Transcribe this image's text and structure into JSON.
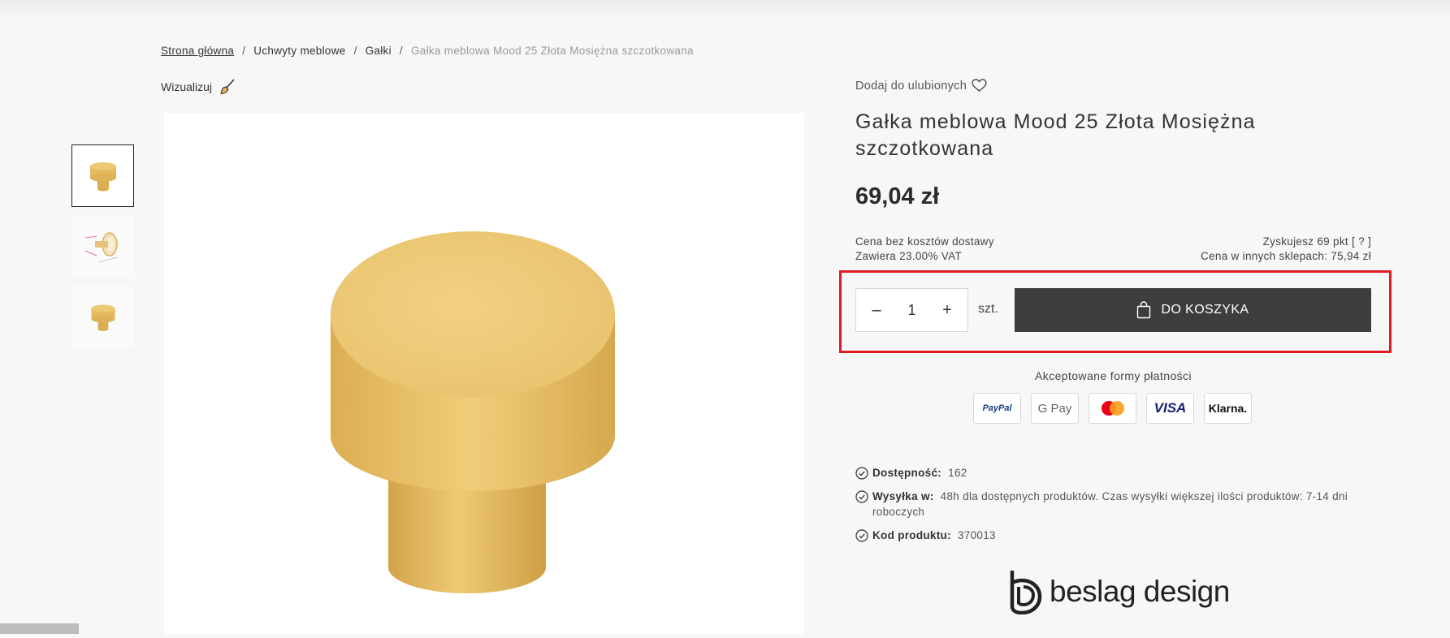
{
  "breadcrumb": {
    "home": "Strona główna",
    "level1": "Uchwyty meblowe",
    "level2": "Gałki",
    "current": "Gałka meblowa Mood 25 Złota Mosiężna szczotkowana",
    "sep": "/"
  },
  "visualize_label": "Wizualizuj",
  "favorites_label": "Dodaj do ulubionych",
  "product": {
    "title": "Gałka meblowa Mood 25 Złota Mosiężna szczotkowana",
    "price": "69,04 zł",
    "shipping_note": "Cena bez kosztów dostawy",
    "vat_note": "Zawiera 23.00% VAT",
    "points": "Zyskujesz 69 pkt [ ? ]",
    "other_shops": "Cena w innych sklepach: 75,94 zł"
  },
  "cart": {
    "minus": "–",
    "plus": "+",
    "quantity": "1",
    "unit": "szt.",
    "button_label": "DO KOSZYKA"
  },
  "payments": {
    "heading": "Akceptowane formy płatności",
    "methods": [
      "PayPal",
      "G Pay",
      "Mastercard",
      "VISA",
      "Klarna."
    ]
  },
  "details": {
    "availability_label": "Dostępność:",
    "availability_value": "162",
    "shipping_label": "Wysyłka w:",
    "shipping_value": "48h dla dostępnych produktów. Czas wysyłki większej ilości produktów: 7-14 dni roboczych",
    "code_label": "Kod produktu:",
    "code_value": "370013"
  },
  "brand": {
    "name": "beslag design"
  },
  "colors": {
    "accent_highlight": "#e21b23",
    "cart_button": "#3d3d3d",
    "knob_gold": "#e0b65a"
  }
}
